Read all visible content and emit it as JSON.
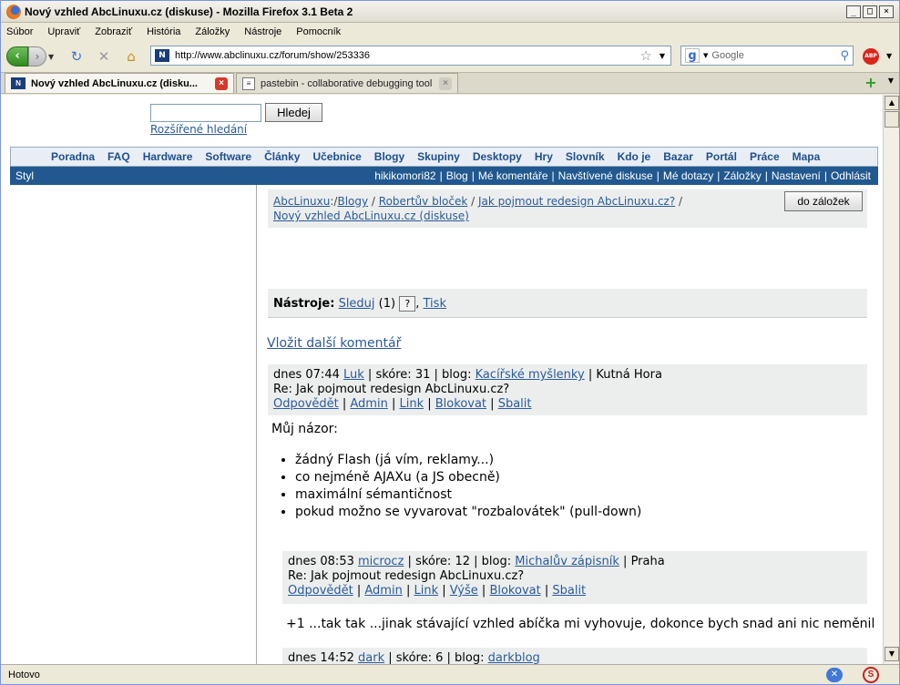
{
  "window": {
    "title": "Nový vzhled AbcLinuxu.cz (diskuse) - Mozilla Firefox 3.1 Beta 2",
    "controls": [
      "_",
      "□",
      "×"
    ]
  },
  "menu": [
    "Súbor",
    "Upraviť",
    "Zobraziť",
    "História",
    "Záložky",
    "Nástroje",
    "Pomocník"
  ],
  "toolbar": {
    "url": "http://www.abclinuxu.cz/forum/show/253336",
    "search_placeholder": "Google",
    "abp": "ABP"
  },
  "tabs": [
    {
      "label": "Nový vzhled AbcLinuxu.cz (disku..."
    },
    {
      "label": "pastebin - collaborative debugging tool"
    }
  ],
  "status": "Hotovo",
  "page": {
    "search_button": "Hledej",
    "advanced_search": "Rozšířené hledání",
    "topnav": [
      "Poradna",
      "FAQ",
      "Hardware",
      "Software",
      "Články",
      "Učebnice",
      "Blogy",
      "Skupiny",
      "Desktopy",
      "Hry",
      "Slovník",
      "Kdo je",
      "Bazar",
      "Portál",
      "Práce",
      "Mapa"
    ],
    "usernav": {
      "styl": "Styl",
      "links": [
        "hikikomori82",
        "Blog",
        "Mé komentáře",
        "Navštívené diskuse",
        "Mé dotazy",
        "Záložky",
        "Nastavení",
        "Odhlásit"
      ]
    },
    "breadcrumb": {
      "root": "AbcLinuxu",
      "sep1": ":/",
      "blogy": "Blogy",
      "sep": " / ",
      "robert": "Robertův bloček",
      "jak": "Jak pojmout redesign AbcLinuxu.cz?",
      "novy": "Nový vzhled AbcLinuxu.cz (diskuse)"
    },
    "bookmark_button": "do záložek",
    "tools": {
      "label": "Nástroje:",
      "sleduj": "Sleduj",
      "count": "(1)",
      "help": "?",
      "comma": ",",
      "tisk": "Tisk"
    },
    "add_comment": "Vložit další komentář",
    "comments": [
      {
        "time": "dnes 07:44",
        "user": "Luk",
        "score": "skóre: 31",
        "blog_label": "blog:",
        "blog": "Kacířské myšlenky",
        "place": "Kutná Hora",
        "subject": "Re: Jak pojmout redesign AbcLinuxu.cz?",
        "actions": [
          "Odpovědět",
          "Admin",
          "Link",
          "Blokovat",
          "Sbalit"
        ],
        "intro": "Můj názor:",
        "bullets": [
          "žádný Flash (já vím, reklamy...)",
          "co nejméně AJAXu (a JS obecně)",
          "maximální sémantičnost",
          "pokud možno se vyvarovat \"rozbalovátek\" (pull-down)"
        ]
      },
      {
        "time": "dnes 08:53",
        "user": "microcz",
        "score": "skóre: 12",
        "blog_label": "blog:",
        "blog": "Michalův zápisník",
        "place": "Praha",
        "subject": "Re: Jak pojmout redesign AbcLinuxu.cz?",
        "actions": [
          "Odpovědět",
          "Admin",
          "Link",
          "Výše",
          "Blokovat",
          "Sbalit"
        ],
        "text": "+1 ...tak tak ...jinak stávající vzhled abíčka mi vyhovuje, dokonce bych snad ani nic neměnil"
      },
      {
        "time": "dnes 14:52",
        "user": "dark",
        "score": "skóre: 6",
        "blog_label": "blog:",
        "blog": "darkblog"
      }
    ]
  }
}
